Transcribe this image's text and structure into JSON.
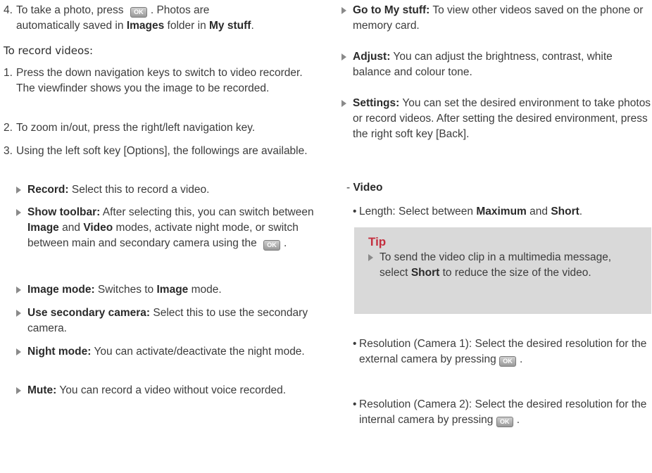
{
  "left": {
    "step4": {
      "num": "4.",
      "pre": "To take a photo, press",
      "post": ". Photos are",
      "line2_pre": "automatically saved in",
      "images": "Images",
      "mid": "folder in",
      "mystuff": "My stuff",
      "end": "."
    },
    "section_title": "To record videos:",
    "step1": {
      "num": "1.",
      "text": "Press the down navigation keys to switch to video recorder. The viewfinder shows you the image to be recorded."
    },
    "step2": {
      "num": "2.",
      "text": "To zoom in/out, press the right/left navigation key."
    },
    "step3": {
      "num": "3.",
      "text": "Using the left soft key [Options], the followings are available."
    },
    "bullets": {
      "record": {
        "label": "Record:",
        "text": "Select this to record a video."
      },
      "toolbar": {
        "label": "Show toolbar:",
        "t1": "After selecting this, you can switch between",
        "image": "Image",
        "and": "and",
        "video": "Video",
        "t2": "modes, activate night mode, or switch between main and secondary camera using the",
        "end": "."
      },
      "imagemode": {
        "label": "Image mode:",
        "text": "Switches to",
        "image": "Image",
        "end": "mode."
      },
      "secondary": {
        "label": "Use secondary camera:",
        "text": "Select this to use the secondary camera."
      },
      "night": {
        "label": "Night mode:",
        "text": "You can activate/deactivate the night mode."
      },
      "mute": {
        "label": "Mute:",
        "text": "You can record a video without voice recorded."
      }
    }
  },
  "right": {
    "gotostuff": {
      "label": "Go to My stuff:",
      "text": "To view other videos saved on the phone or memory card."
    },
    "adjust": {
      "label": "Adjust:",
      "text": "You can adjust the brightness, contrast, white balance and colour tone."
    },
    "settings": {
      "label": "Settings:",
      "text": "You can set the desired environment to take photos or record videos. After setting the desired environment, press the right soft key [Back]."
    },
    "video_dash": "-",
    "video_label": "Video",
    "length": {
      "pre": "Length: Select between",
      "max": "Maximum",
      "and": "and",
      "short": "Short",
      "end": "."
    },
    "tip": {
      "title": "Tip",
      "pre": "To send the video clip in a multimedia message, select",
      "short": "Short",
      "post": "to reduce the size of the video."
    },
    "res1": {
      "text": "Resolution (Camera 1): Select the desired resolution for the external camera by pressing",
      "end": "."
    },
    "res2": {
      "text": "Resolution (Camera 2): Select the desired resolution for the internal camera by pressing",
      "end": "."
    }
  },
  "ok_key": "OK",
  "colors": {
    "tip_title": "#c42f3f",
    "tip_bg": "#d9d9d9",
    "arrow": "#8a8a8a"
  }
}
